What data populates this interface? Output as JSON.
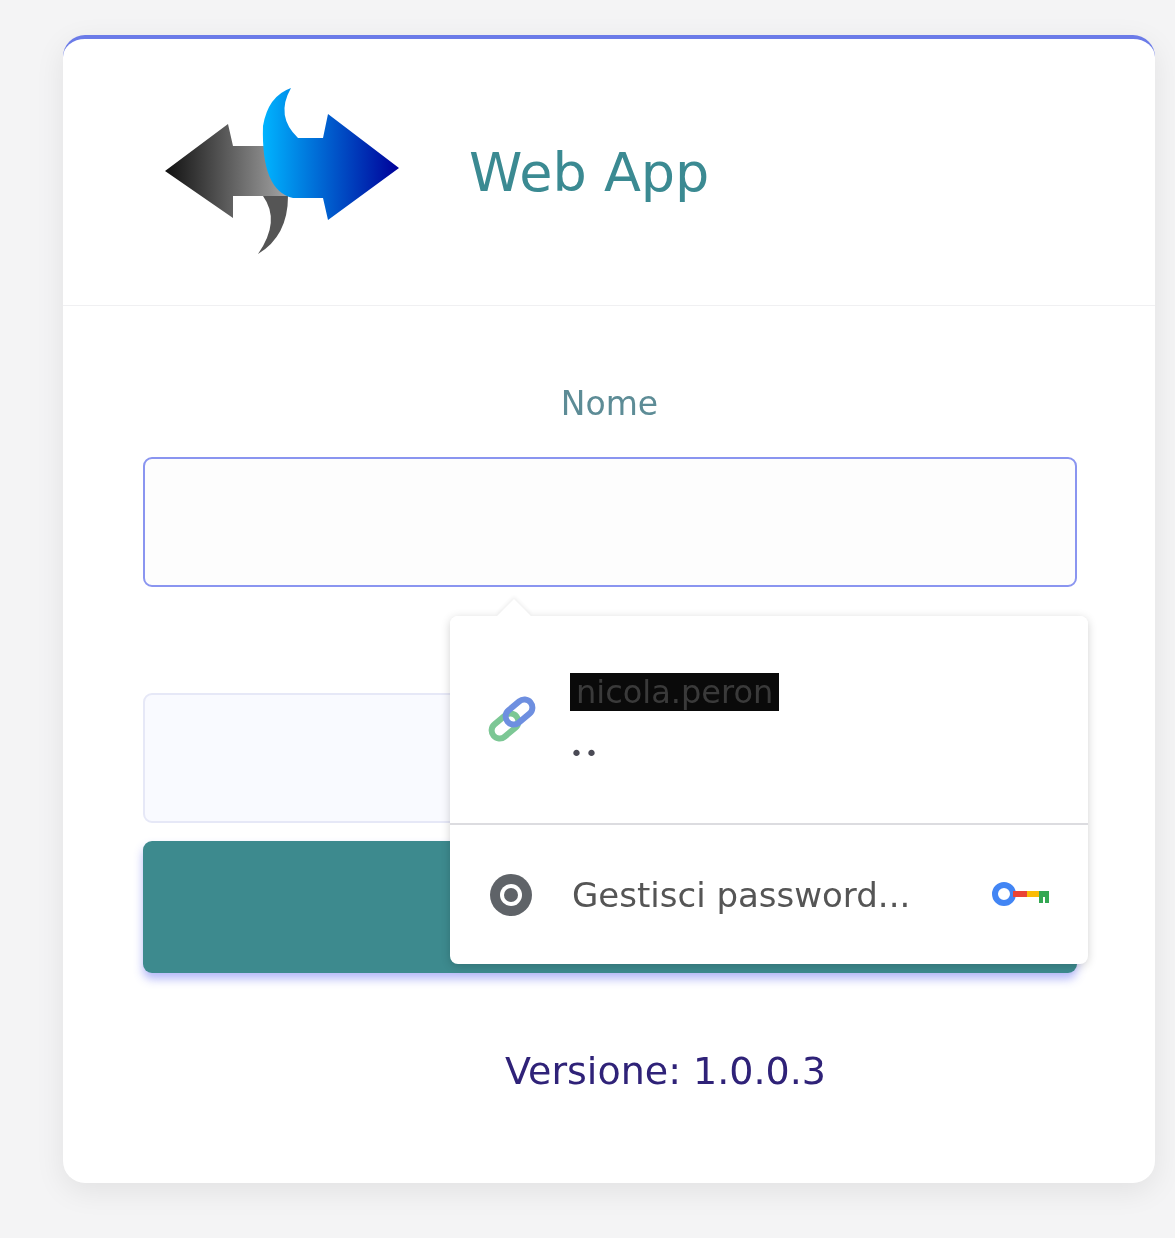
{
  "app": {
    "title": "Web App"
  },
  "form": {
    "fields": [
      {
        "label": "Nome",
        "focused": true
      },
      {
        "focused": false
      }
    ]
  },
  "autofill_popup": {
    "suggestions": [
      {
        "username": "nicola.peron",
        "password_mask": "••"
      }
    ],
    "manage_link": "Gestisci password..."
  },
  "footer": {
    "version": "Versione: 1.0.0.3"
  }
}
